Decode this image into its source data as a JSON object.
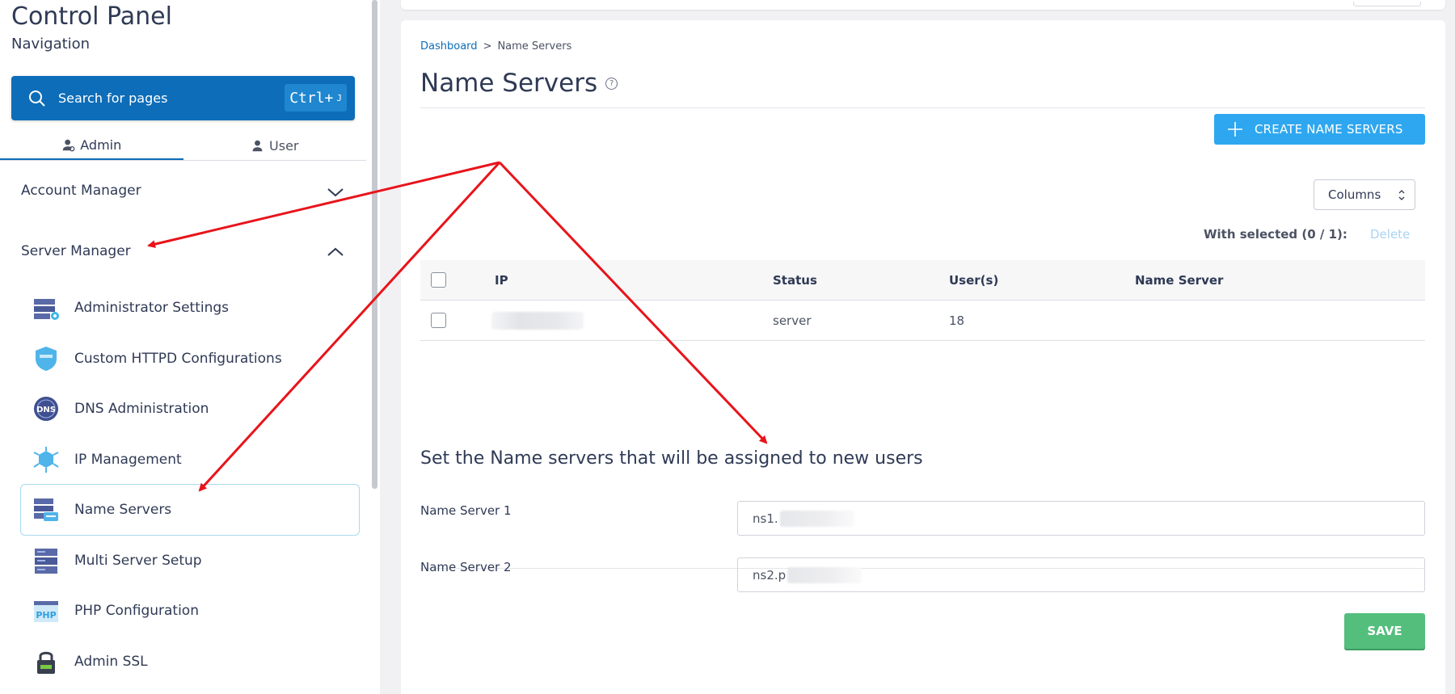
{
  "sidebar": {
    "title": "Control Panel",
    "subtitle": "Navigation",
    "search": {
      "label": "Search for pages",
      "shortcut_main": "Ctrl+",
      "shortcut_key": "J"
    },
    "tabs": [
      {
        "label": "Admin",
        "icon": "admin-user-icon"
      },
      {
        "label": "User",
        "icon": "user-icon"
      }
    ],
    "groups": [
      {
        "label": "Account Manager",
        "state": "collapsed"
      },
      {
        "label": "Server Manager",
        "state": "expanded"
      }
    ],
    "items": [
      {
        "label": "Administrator Settings",
        "icon": "admin-settings-icon"
      },
      {
        "label": "Custom HTTPD Configurations",
        "icon": "httpd-shield-icon"
      },
      {
        "label": "DNS Administration",
        "icon": "dns-globe-icon"
      },
      {
        "label": "IP Management",
        "icon": "ip-network-icon"
      },
      {
        "label": "Name Servers",
        "icon": "name-servers-icon",
        "active": true
      },
      {
        "label": "Multi Server Setup",
        "icon": "multi-server-icon"
      },
      {
        "label": "PHP Configuration",
        "icon": "php-icon"
      },
      {
        "label": "Admin SSL",
        "icon": "ssl-lock-icon"
      }
    ]
  },
  "main": {
    "breadcrumb": {
      "root": "Dashboard",
      "separator": ">",
      "current": "Name Servers"
    },
    "title": "Name Servers",
    "help_glyph": "?",
    "create_button": "CREATE NAME SERVERS",
    "columns_button": "Columns",
    "with_selected": "With selected (0 / 1):",
    "delete_label": "Delete",
    "table": {
      "headers": [
        "IP",
        "Status",
        "User(s)",
        "Name Server"
      ],
      "rows": [
        {
          "ip": "",
          "status": "server",
          "users": "18",
          "name_server": ""
        }
      ]
    },
    "section_title": "Set the Name servers that will be assigned to new users",
    "fields": [
      {
        "label": "Name Server 1",
        "value": "ns1."
      },
      {
        "label": "Name Server 2",
        "value": "ns2.p"
      }
    ],
    "save_button": "SAVE"
  },
  "colors": {
    "primary": "#0d6db8",
    "create": "#2ea7f0",
    "save": "#54be7d",
    "annotation_arrow": "#e8141b"
  }
}
